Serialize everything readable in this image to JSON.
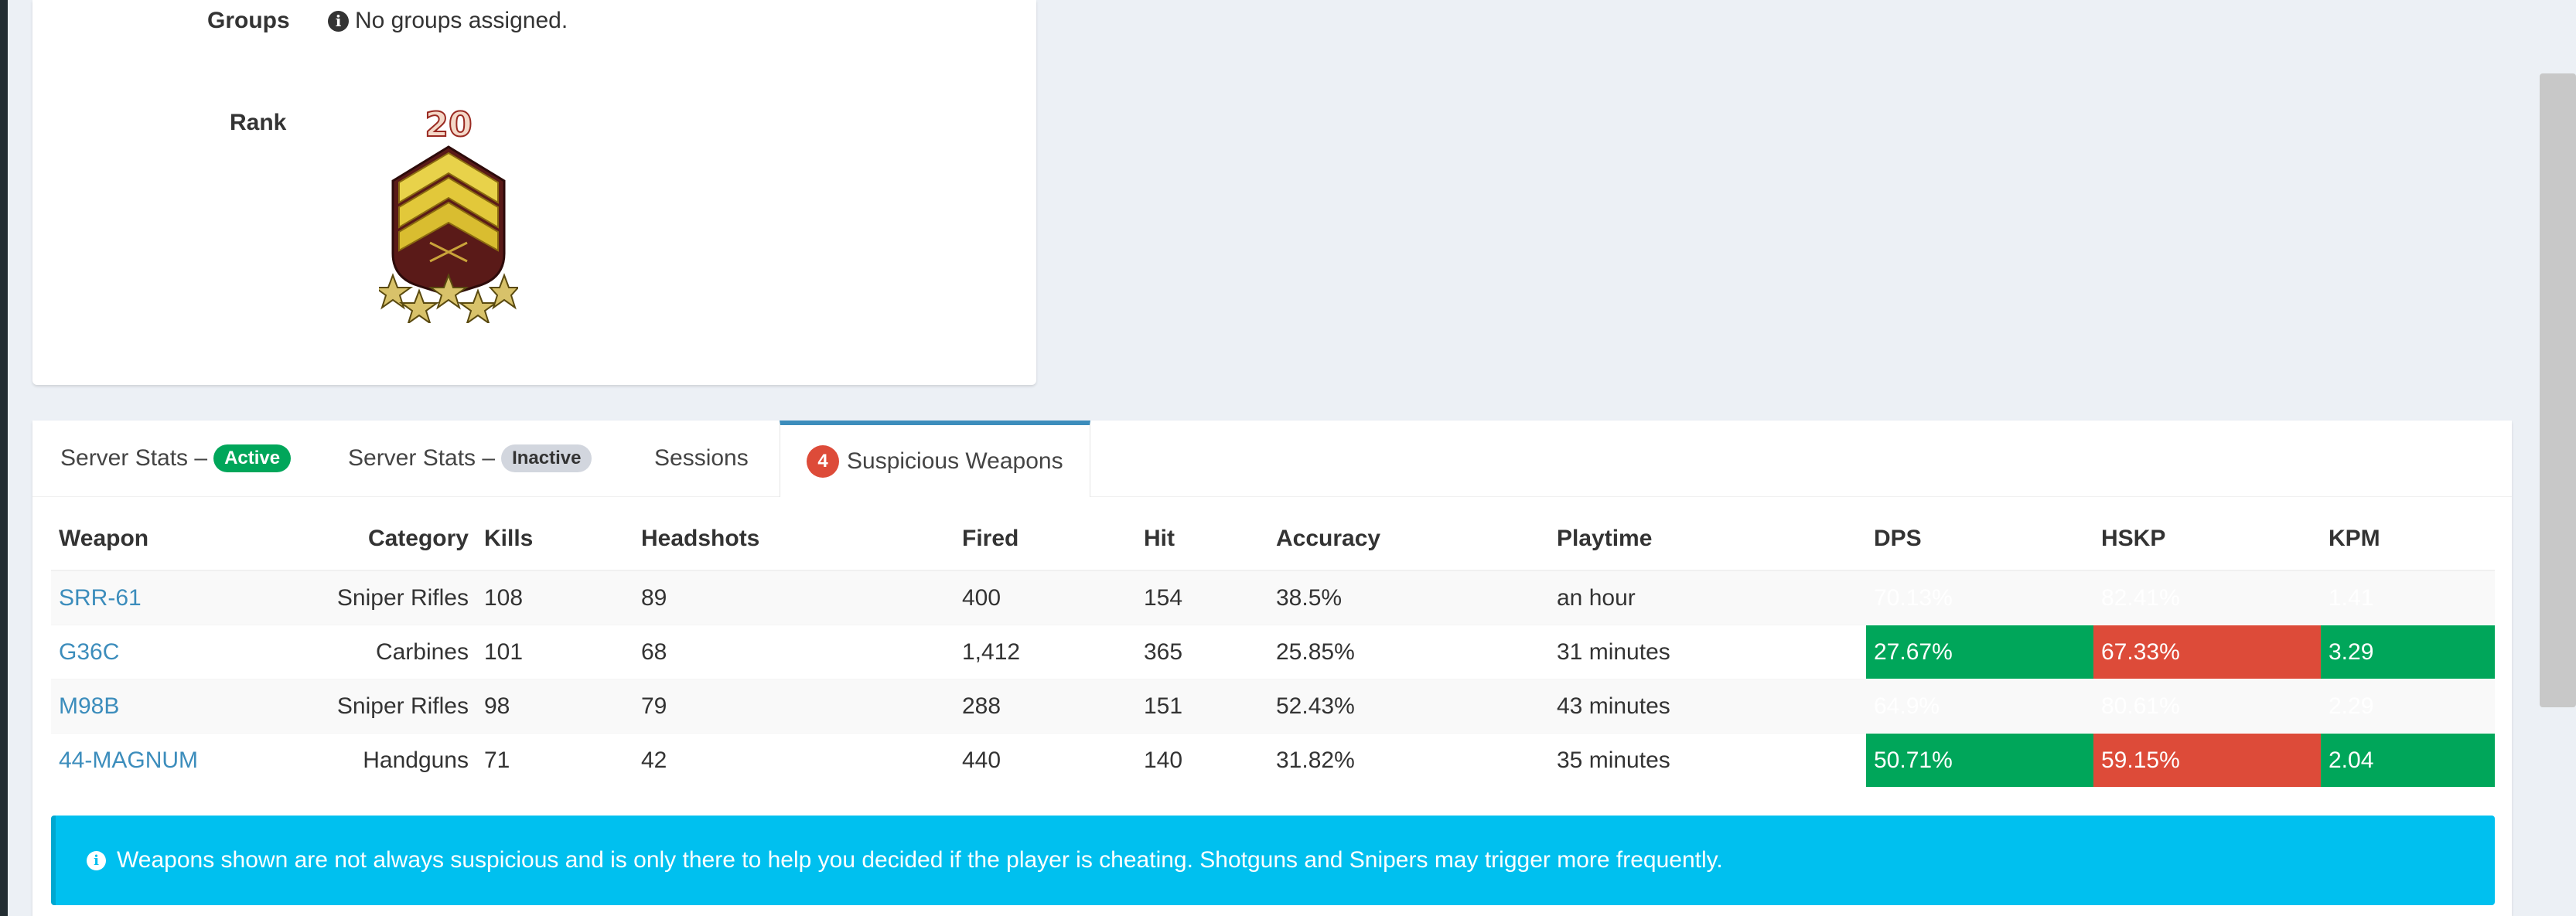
{
  "profile": {
    "groups_label": "Groups",
    "groups_value": "No groups assigned.",
    "rank_label": "Rank",
    "rank_number": "20"
  },
  "tabs": [
    {
      "label": "Server Stats –",
      "badge": "Active",
      "badge_color": "#00a65a"
    },
    {
      "label": "Server Stats –",
      "badge": "Inactive",
      "badge_color": "#d2d6de"
    },
    {
      "label": "Sessions",
      "badge": ""
    },
    {
      "label": "Suspicious Weapons",
      "badge": "4",
      "badge_color": "#dd4b39",
      "active": true
    }
  ],
  "table": {
    "headers": [
      "Weapon",
      "Category",
      "Kills",
      "Headshots",
      "Fired",
      "Hit",
      "Accuracy",
      "Playtime",
      "DPS",
      "HSKP",
      "KPM"
    ],
    "rows": [
      {
        "weapon": "SRR-61",
        "category": "Sniper Rifles",
        "kills": "108",
        "headshots": "89",
        "fired": "400",
        "hit": "154",
        "accuracy": "38.5%",
        "playtime": "an hour",
        "dps": "70.13%",
        "hskp": "82.41%",
        "kpm": "1.41"
      },
      {
        "weapon": "G36C",
        "category": "Carbines",
        "kills": "101",
        "headshots": "68",
        "fired": "1,412",
        "hit": "365",
        "accuracy": "25.85%",
        "playtime": "31 minutes",
        "dps": "27.67%",
        "hskp": "67.33%",
        "kpm": "3.29"
      },
      {
        "weapon": "M98B",
        "category": "Sniper Rifles",
        "kills": "98",
        "headshots": "79",
        "fired": "288",
        "hit": "151",
        "accuracy": "52.43%",
        "playtime": "43 minutes",
        "dps": "64.9%",
        "hskp": "80.61%",
        "kpm": "2.29"
      },
      {
        "weapon": "44-MAGNUM",
        "category": "Handguns",
        "kills": "71",
        "headshots": "42",
        "fired": "440",
        "hit": "140",
        "accuracy": "31.82%",
        "playtime": "35 minutes",
        "dps": "50.71%",
        "hskp": "59.15%",
        "kpm": "2.04"
      }
    ]
  },
  "callout": {
    "text": "Weapons shown are not always suspicious and is only there to help you decided if the player is cheating. Shotguns and Snipers may trigger more frequently."
  },
  "colors": {
    "accent": "#3c8dbc",
    "ok": "#00a65a",
    "danger": "#dd4b39",
    "info": "#00c0ef"
  }
}
